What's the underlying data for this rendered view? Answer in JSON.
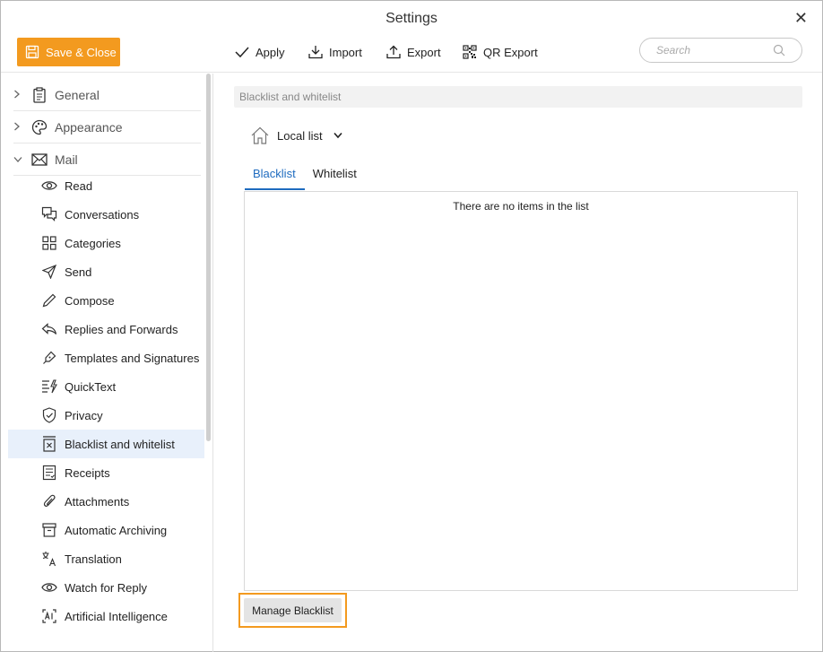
{
  "window": {
    "title": "Settings"
  },
  "toolbar": {
    "save_close": "Save & Close",
    "apply": "Apply",
    "import": "Import",
    "export": "Export",
    "qr_export": "QR Export",
    "search_placeholder": "Search"
  },
  "sidebar": {
    "sections": [
      {
        "label": "General",
        "icon": "clipboard-icon",
        "expanded": false
      },
      {
        "label": "Appearance",
        "icon": "palette-icon",
        "expanded": false
      },
      {
        "label": "Mail",
        "icon": "envelope-icon",
        "expanded": true
      }
    ],
    "mail_items": [
      {
        "label": "Read",
        "icon": "eye-icon"
      },
      {
        "label": "Conversations",
        "icon": "chat-icon"
      },
      {
        "label": "Categories",
        "icon": "grid-icon"
      },
      {
        "label": "Send",
        "icon": "paper-plane-icon"
      },
      {
        "label": "Compose",
        "icon": "pencil-icon"
      },
      {
        "label": "Replies and Forwards",
        "icon": "reply-icon"
      },
      {
        "label": "Templates and Signatures",
        "icon": "pen-nib-icon"
      },
      {
        "label": "QuickText",
        "icon": "quicktext-icon"
      },
      {
        "label": "Privacy",
        "icon": "shield-icon"
      },
      {
        "label": "Blacklist and whitelist",
        "icon": "blocked-list-icon",
        "active": true
      },
      {
        "label": "Receipts",
        "icon": "receipt-icon"
      },
      {
        "label": "Attachments",
        "icon": "paperclip-icon"
      },
      {
        "label": "Automatic Archiving",
        "icon": "archive-box-icon"
      },
      {
        "label": "Translation",
        "icon": "translate-icon"
      },
      {
        "label": "Watch for Reply",
        "icon": "eye-icon"
      },
      {
        "label": "Artificial Intelligence",
        "icon": "ai-icon"
      }
    ]
  },
  "main": {
    "section_header": "Blacklist and whitelist",
    "list_source": "Local list",
    "tabs": [
      {
        "label": "Blacklist",
        "active": true
      },
      {
        "label": "Whitelist",
        "active": false
      }
    ],
    "empty_message": "There are no items in the list",
    "manage_button": "Manage Blacklist"
  },
  "colors": {
    "accent": "#f39a1f",
    "tab_active": "#1e6bbf",
    "selected_row": "#e8f0fb"
  }
}
